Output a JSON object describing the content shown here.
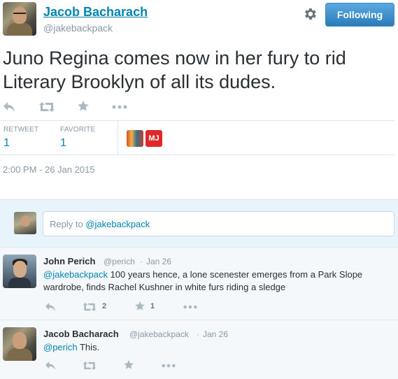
{
  "tweet": {
    "author_name": "Jacob Bacharach",
    "author_handle": "@jakebackpack",
    "follow_button_label": "Following",
    "text": "Juno Regina comes now in her fury to rid Literary Brooklyn of all its dudes.",
    "stats": {
      "retweet_label": "RETWEET",
      "retweet_count": "1",
      "favorite_label": "FAVORITE",
      "favorite_count": "1"
    },
    "favoriter_badge": "MJ",
    "timestamp": "2:00 PM - 26 Jan 2015"
  },
  "reply_box": {
    "placeholder_prefix": "Reply to ",
    "placeholder_handle": "@jakebackpack"
  },
  "replies": [
    {
      "name": "John Perich",
      "handle": "@perich",
      "separator": "·",
      "date": "Jan 26",
      "mention": "@jakebackpack",
      "text": " 100 years hence, a lone scenester emerges from a Park Slope wardrobe, finds Rachel Kushner in white furs riding a sledge",
      "retweet_count": "2",
      "favorite_count": "1"
    },
    {
      "name": "Jacob Bacharach",
      "handle": "@jakebackpack",
      "separator": "·",
      "date": "Jan 26",
      "mention": "@perich",
      "text": " This.",
      "retweet_count": "",
      "favorite_count": ""
    }
  ],
  "icons": {
    "reply": "reply-icon",
    "retweet": "retweet-icon",
    "favorite": "star-icon",
    "more": "more-icon",
    "settings": "gear-icon"
  },
  "colors": {
    "link": "#0084b4",
    "follow_button": "#2b7bb9",
    "muted": "#8899a6",
    "icon": "#aab8c2",
    "reply_background": "#e8f4fb"
  }
}
